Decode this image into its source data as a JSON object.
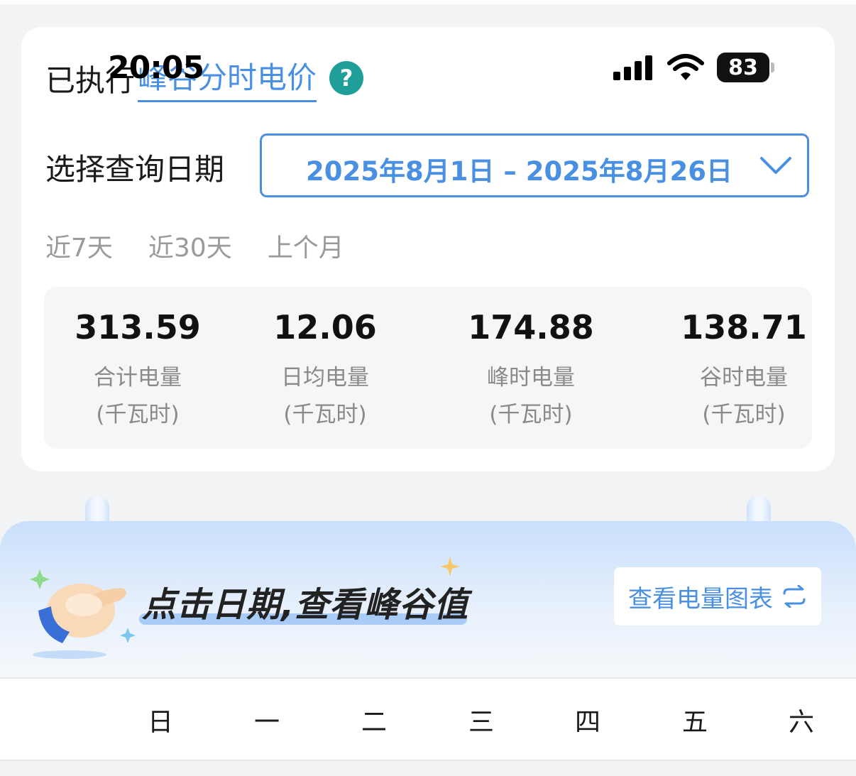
{
  "status_bar": {
    "time": "20:05",
    "battery": "83"
  },
  "summary": {
    "title_prefix": "已执行",
    "title_link": "峰谷分时电价",
    "help_icon": "question-circle-icon",
    "date_label": "选择查询日期",
    "date_range": "2025年8月1日 – 2025年8月26日",
    "quick_ranges": [
      "近7天",
      "近30天",
      "上个月"
    ],
    "stats": [
      {
        "value": "313.59",
        "label": "合计电量",
        "unit": "(千瓦时)"
      },
      {
        "value": "12.06",
        "label": "日均电量",
        "unit": "(千瓦时)"
      },
      {
        "value": "174.88",
        "label": "峰时电量",
        "unit": "(千瓦时)"
      },
      {
        "value": "138.71",
        "label": "谷时电量",
        "unit": "(千瓦时)"
      }
    ]
  },
  "calendar": {
    "hint": "点击日期,查看峰谷值",
    "chart_button": "查看电量图表",
    "weekdays": [
      "日",
      "一",
      "二",
      "三",
      "四",
      "五",
      "六"
    ]
  },
  "colors": {
    "accent": "#4a90e2",
    "help": "#1f9e9a"
  }
}
